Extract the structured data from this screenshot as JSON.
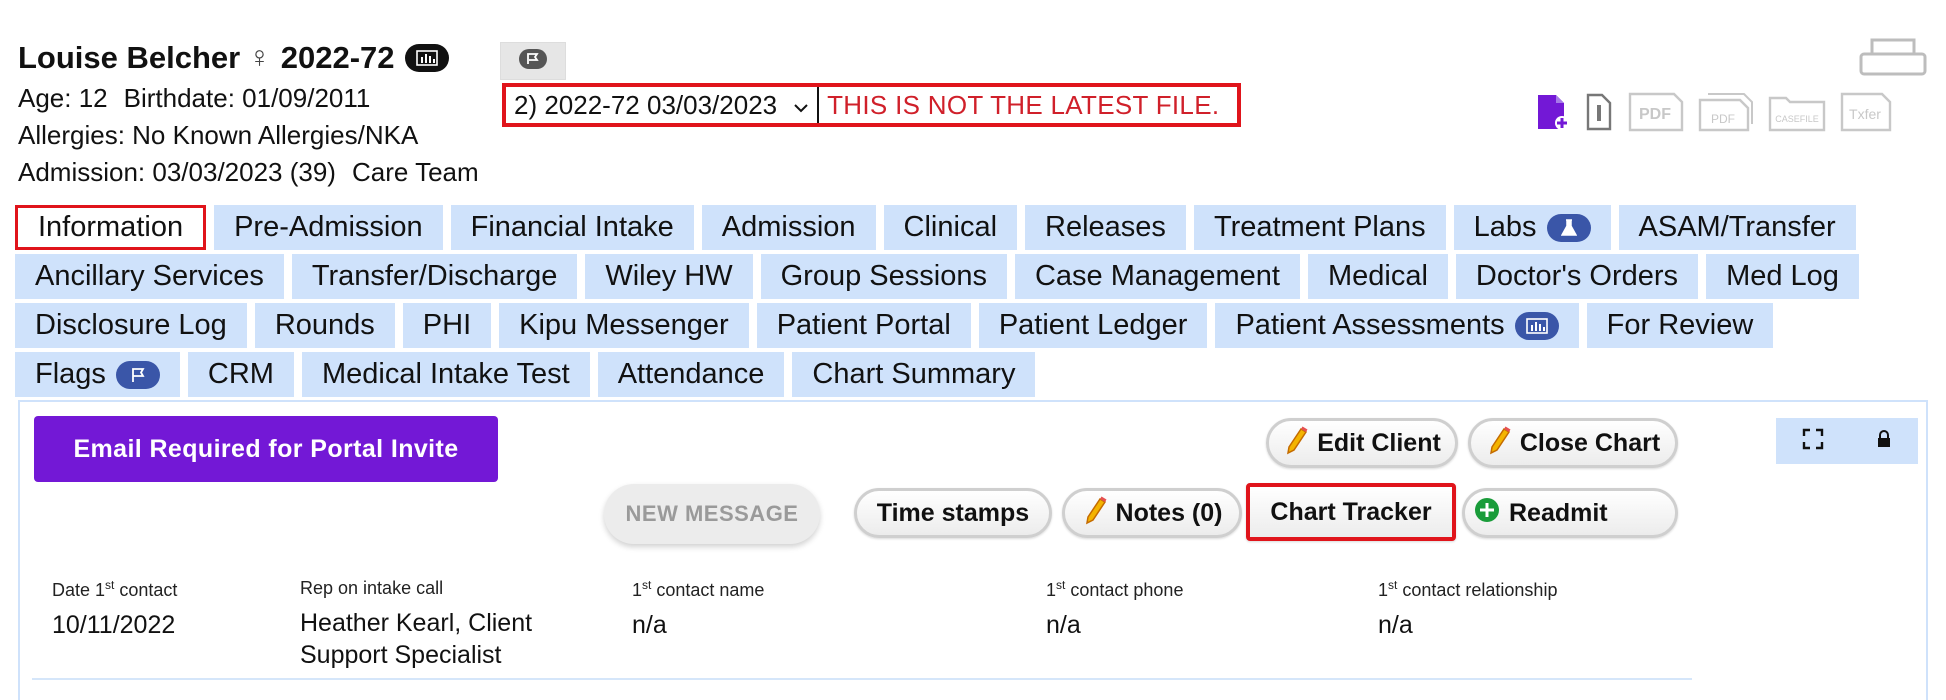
{
  "patient": {
    "name": "Louise Belcher",
    "gender_symbol": "♀",
    "id": "2022-72",
    "age_label": "Age: 12",
    "birthdate_label": "Birthdate: 01/09/2011",
    "allergies_label": "Allergies: No Known Allergies/NKA",
    "admission_label": "Admission: 03/03/2023 (39)",
    "care_team_label": "Care Team"
  },
  "file_selector": {
    "selected": "2) 2022-72 03/03/2023",
    "warning": "THIS IS NOT THE LATEST FILE."
  },
  "toolbar_icons": {
    "pdf_label": "PDF",
    "pdf2_label": "PDF",
    "casefile_label": "CASEFILE",
    "txfer_label": "Txfer"
  },
  "tabs": {
    "row1": [
      "Information",
      "Pre-Admission",
      "Financial Intake",
      "Admission",
      "Clinical",
      "Releases",
      "Treatment Plans",
      "Labs",
      "ASAM/Transfer"
    ],
    "row2": [
      "Ancillary Services",
      "Transfer/Discharge",
      "Wiley HW",
      "Group Sessions",
      "Case Management",
      "Medical",
      "Doctor's Orders",
      "Med Log"
    ],
    "row3": [
      "Disclosure Log",
      "Rounds",
      "PHI",
      "Kipu Messenger",
      "Patient Portal",
      "Patient Ledger",
      "Patient Assessments",
      "For Review"
    ],
    "row4": [
      "Flags",
      "CRM",
      "Medical Intake Test",
      "Attendance",
      "Chart Summary"
    ]
  },
  "panel": {
    "email_button": "Email Required for Portal Invite",
    "edit_client": "Edit Client",
    "close_chart": "Close Chart",
    "new_message": "NEW MESSAGE",
    "time_stamps": "Time stamps",
    "notes": "Notes (0)",
    "chart_tracker": "Chart Tracker",
    "readmit": "Readmit"
  },
  "contact_fields": {
    "date_label_pre": "Date 1",
    "date_label_sup": "st",
    "date_label_post": " contact",
    "date_value": "10/11/2022",
    "rep_label": "Rep on intake call",
    "rep_value": "Heather Kearl, Client Support Specialist",
    "name_label_sup": "st",
    "name_label_post": " contact name",
    "name_value": "n/a",
    "phone_label_post": " contact phone",
    "phone_value": "n/a",
    "rel_label_post": " contact relationship",
    "rel_value": "n/a",
    "one": "1"
  },
  "colors": {
    "tab_bg": "#cfe2fb",
    "highlight_red": "#e0141b",
    "email_purple": "#7318d6",
    "badge_blue": "#3a56a8"
  }
}
